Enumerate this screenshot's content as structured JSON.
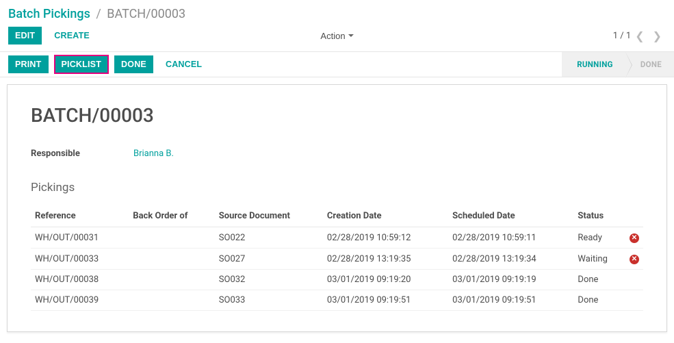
{
  "breadcrumb": {
    "parent": "Batch Pickings",
    "separator": "/",
    "current": "BATCH/00003"
  },
  "controls": {
    "edit": "EDIT",
    "create": "CREATE",
    "action": "Action",
    "pager": "1 / 1"
  },
  "buttonbar": {
    "print": "PRINT",
    "picklist": "PICKLIST",
    "done": "DONE",
    "cancel": "CANCEL"
  },
  "statusbar": {
    "running": "RUNNING",
    "done": "DONE"
  },
  "record": {
    "title": "BATCH/00003",
    "responsible_label": "Responsible",
    "responsible_value": "Brianna B."
  },
  "pickings": {
    "section_title": "Pickings",
    "columns": {
      "reference": "Reference",
      "back_order": "Back Order of",
      "source_doc": "Source Document",
      "creation_date": "Creation Date",
      "scheduled_date": "Scheduled Date",
      "status": "Status"
    },
    "rows": [
      {
        "reference": "WH/OUT/00031",
        "back_order": "",
        "source_doc": "SO022",
        "creation_date": "02/28/2019 10:59:12",
        "scheduled_date": "02/28/2019 10:59:11",
        "status": "Ready",
        "deletable": true
      },
      {
        "reference": "WH/OUT/00033",
        "back_order": "",
        "source_doc": "SO027",
        "creation_date": "02/28/2019 13:19:35",
        "scheduled_date": "02/28/2019 13:19:34",
        "status": "Waiting",
        "deletable": true
      },
      {
        "reference": "WH/OUT/00038",
        "back_order": "",
        "source_doc": "SO032",
        "creation_date": "03/01/2019 09:19:20",
        "scheduled_date": "03/01/2019 09:19:19",
        "status": "Done",
        "deletable": false
      },
      {
        "reference": "WH/OUT/00039",
        "back_order": "",
        "source_doc": "SO033",
        "creation_date": "03/01/2019 09:19:51",
        "scheduled_date": "03/01/2019 09:19:51",
        "status": "Done",
        "deletable": false
      }
    ]
  }
}
